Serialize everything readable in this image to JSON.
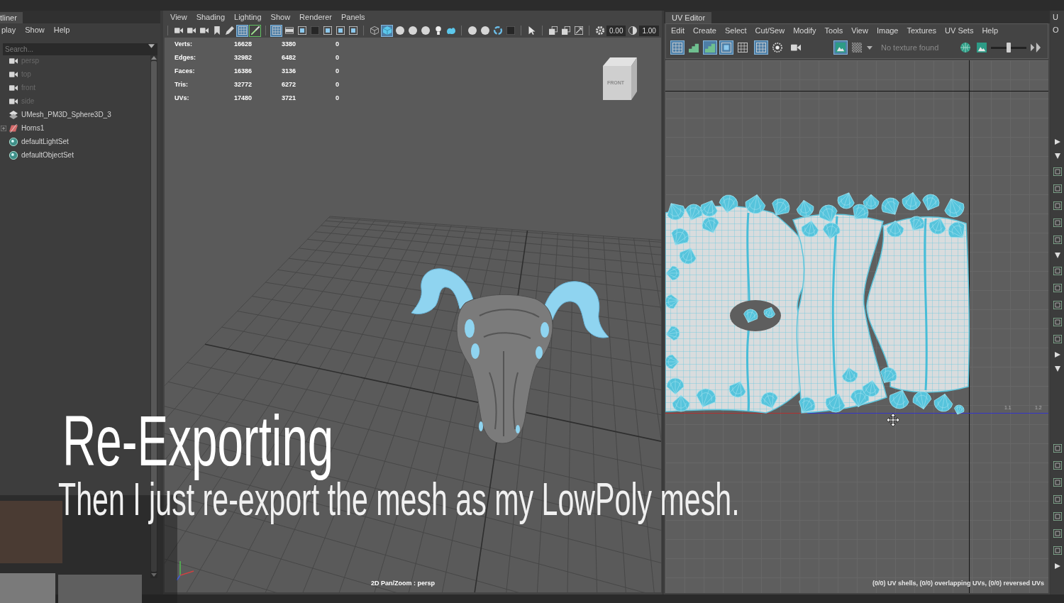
{
  "outliner": {
    "tab": "tliner",
    "menu": [
      "play",
      "Show",
      "Help"
    ],
    "search": {
      "placeholder": "Search..."
    },
    "items": [
      {
        "label": "persp",
        "kind": "camera",
        "dimmed": true,
        "expandable": false
      },
      {
        "label": "top",
        "kind": "camera",
        "dimmed": true,
        "expandable": false
      },
      {
        "label": "front",
        "kind": "camera",
        "dimmed": true,
        "expandable": false
      },
      {
        "label": "side",
        "kind": "camera",
        "dimmed": true,
        "expandable": false
      },
      {
        "label": "UMesh_PM3D_Sphere3D_3",
        "kind": "mesh",
        "dimmed": false,
        "expandable": false
      },
      {
        "label": "Horns1",
        "kind": "transform",
        "dimmed": false,
        "expandable": true
      },
      {
        "label": "defaultLightSet",
        "kind": "set",
        "dimmed": false,
        "expandable": false
      },
      {
        "label": "defaultObjectSet",
        "kind": "set",
        "dimmed": false,
        "expandable": false
      }
    ]
  },
  "viewport": {
    "menu": [
      "View",
      "Shading",
      "Lighting",
      "Show",
      "Renderer",
      "Panels"
    ],
    "toolbar": [
      [
        {
          "kind": "tool",
          "selected": false,
          "outlined": false
        },
        {
          "kind": "tool",
          "selected": false,
          "outlined": false
        },
        {
          "kind": "tool",
          "selected": false,
          "outlined": false
        },
        {
          "kind": "tool",
          "selected": false,
          "outlined": false
        },
        {
          "kind": "tool",
          "selected": false,
          "outlined": false
        },
        {
          "kind": "tool",
          "selected": true,
          "outlined": false
        },
        {
          "kind": "tool",
          "selected": false,
          "outlined": true
        }
      ],
      [
        {
          "kind": "tool",
          "selected": true,
          "outlined": false
        },
        {
          "kind": "tool",
          "selected": false,
          "outlined": false
        },
        {
          "kind": "tool",
          "selected": false,
          "outlined": false
        },
        {
          "kind": "tool",
          "selected": false,
          "outlined": false
        },
        {
          "kind": "tool",
          "selected": false,
          "outlined": false
        },
        {
          "kind": "tool",
          "selected": false,
          "outlined": false
        },
        {
          "kind": "tool",
          "selected": false,
          "outlined": false
        }
      ],
      [
        {
          "kind": "tool",
          "selected": false,
          "outlined": false
        },
        {
          "kind": "tool",
          "selected": true,
          "outlined": false
        },
        {
          "kind": "tool",
          "selected": false,
          "outlined": false
        },
        {
          "kind": "tool",
          "selected": false,
          "outlined": false
        },
        {
          "kind": "tool",
          "selected": false,
          "outlined": false
        },
        {
          "kind": "tool",
          "selected": false,
          "outlined": false
        },
        {
          "kind": "tool",
          "selected": false,
          "outlined": false
        }
      ],
      [
        {
          "kind": "tool",
          "selected": false,
          "outlined": false
        },
        {
          "kind": "tool",
          "selected": false,
          "outlined": false
        },
        {
          "kind": "tool",
          "selected": false,
          "outlined": false
        },
        {
          "kind": "tool",
          "selected": false,
          "outlined": false
        }
      ],
      [
        {
          "kind": "tool",
          "selected": false,
          "outlined": false
        }
      ],
      [
        {
          "kind": "tool",
          "selected": false,
          "outlined": false
        },
        {
          "kind": "tool",
          "selected": false,
          "outlined": false
        },
        {
          "kind": "tool",
          "selected": false,
          "outlined": false
        }
      ],
      [
        {
          "kind": "tool",
          "selected": false,
          "outlined": false
        },
        {
          "kind": "field",
          "value": "0.00"
        },
        {
          "kind": "tool",
          "selected": false,
          "outlined": false
        },
        {
          "kind": "field",
          "value": "1.00"
        }
      ]
    ],
    "stats": [
      {
        "label": "Verts:",
        "values": [
          "16628",
          "3380",
          "0"
        ]
      },
      {
        "label": "Edges:",
        "values": [
          "32982",
          "6482",
          "0"
        ]
      },
      {
        "label": "Faces:",
        "values": [
          "16386",
          "3136",
          "0"
        ]
      },
      {
        "label": "Tris:",
        "values": [
          "32772",
          "6272",
          "0"
        ]
      },
      {
        "label": "UVs:",
        "values": [
          "17480",
          "3721",
          "0"
        ]
      }
    ],
    "view_cube": {
      "label": "FRONT"
    },
    "status": "2D Pan/Zoom : persp"
  },
  "uv_editor": {
    "tab": "UV Editor",
    "menu": [
      "Edit",
      "Create",
      "Select",
      "Cut/Sew",
      "Modify",
      "Tools",
      "View",
      "Image",
      "Textures",
      "UV Sets",
      "Help"
    ],
    "toolbar": [
      [
        {
          "kind": "tool",
          "selected": true
        },
        {
          "kind": "tool",
          "selected": false
        },
        {
          "kind": "tool",
          "selected": true
        },
        {
          "kind": "tool",
          "selected": true
        },
        {
          "kind": "tool",
          "selected": false
        }
      ],
      [
        {
          "kind": "tool",
          "selected": true
        },
        {
          "kind": "tool",
          "selected": false
        }
      ],
      [
        {
          "kind": "tool",
          "selected": false
        }
      ],
      [
        {
          "kind": "tool",
          "selected": true
        },
        {
          "kind": "tool",
          "selected": false
        },
        {
          "kind": "dropdown"
        },
        {
          "kind": "text",
          "text": "No texture found"
        }
      ],
      [
        {
          "kind": "tool",
          "selected": false
        },
        {
          "kind": "tool",
          "selected": false
        },
        {
          "kind": "slider",
          "level": 0.5
        },
        {
          "kind": "tool",
          "selected": false
        }
      ]
    ],
    "axis_labels": [
      "1.1",
      "1.2"
    ],
    "status": "(0/0) UV shells, (0/0) overlapping UVs, (0/0) reversed UVs"
  },
  "right_panel": {
    "tab": "U",
    "menu": "O",
    "sections": [
      {
        "expanded": false
      },
      {
        "expanded": true
      },
      {
        "expanded": true
      },
      {
        "expanded": false
      },
      {
        "expanded": true
      },
      {
        "expanded": false
      }
    ]
  },
  "captions": {
    "title": "Re-Exporting",
    "subtitle": "Then I just re-export the mesh as my LowPoly mesh."
  }
}
